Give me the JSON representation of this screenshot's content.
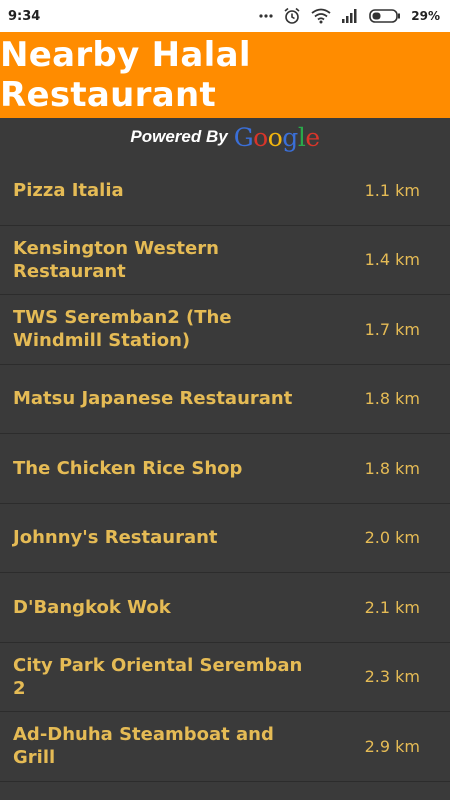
{
  "status_bar": {
    "time": "9:34",
    "battery_percent": "29%",
    "icons": [
      "dots-icon",
      "alarm-icon",
      "wifi-icon",
      "signal-icon",
      "battery-icon"
    ]
  },
  "header": {
    "title": "Nearby Halal Restaurant",
    "background_color": "#ff8c00"
  },
  "attribution": {
    "powered_by": "Powered By",
    "google": {
      "letters": [
        "G",
        "o",
        "o",
        "g",
        "l",
        "e"
      ]
    }
  },
  "restaurants": [
    {
      "name": "Pizza Italia",
      "distance": "1.1 km"
    },
    {
      "name": "Kensington Western Restaurant",
      "distance": "1.4 km"
    },
    {
      "name": "TWS Seremban2 (The Windmill Station)",
      "distance": "1.7 km"
    },
    {
      "name": "Matsu Japanese Restaurant",
      "distance": "1.8 km"
    },
    {
      "name": "The Chicken Rice Shop",
      "distance": "1.8 km"
    },
    {
      "name": "Johnny's Restaurant",
      "distance": "2.0 km"
    },
    {
      "name": "D'Bangkok Wok",
      "distance": "2.1 km"
    },
    {
      "name": "City Park Oriental Seremban 2",
      "distance": "2.3 km"
    },
    {
      "name": "Ad-Dhuha Steamboat and Grill",
      "distance": "2.9 km"
    }
  ],
  "colors": {
    "list_background": "#3a3a3a",
    "list_text": "#e5bb55"
  }
}
